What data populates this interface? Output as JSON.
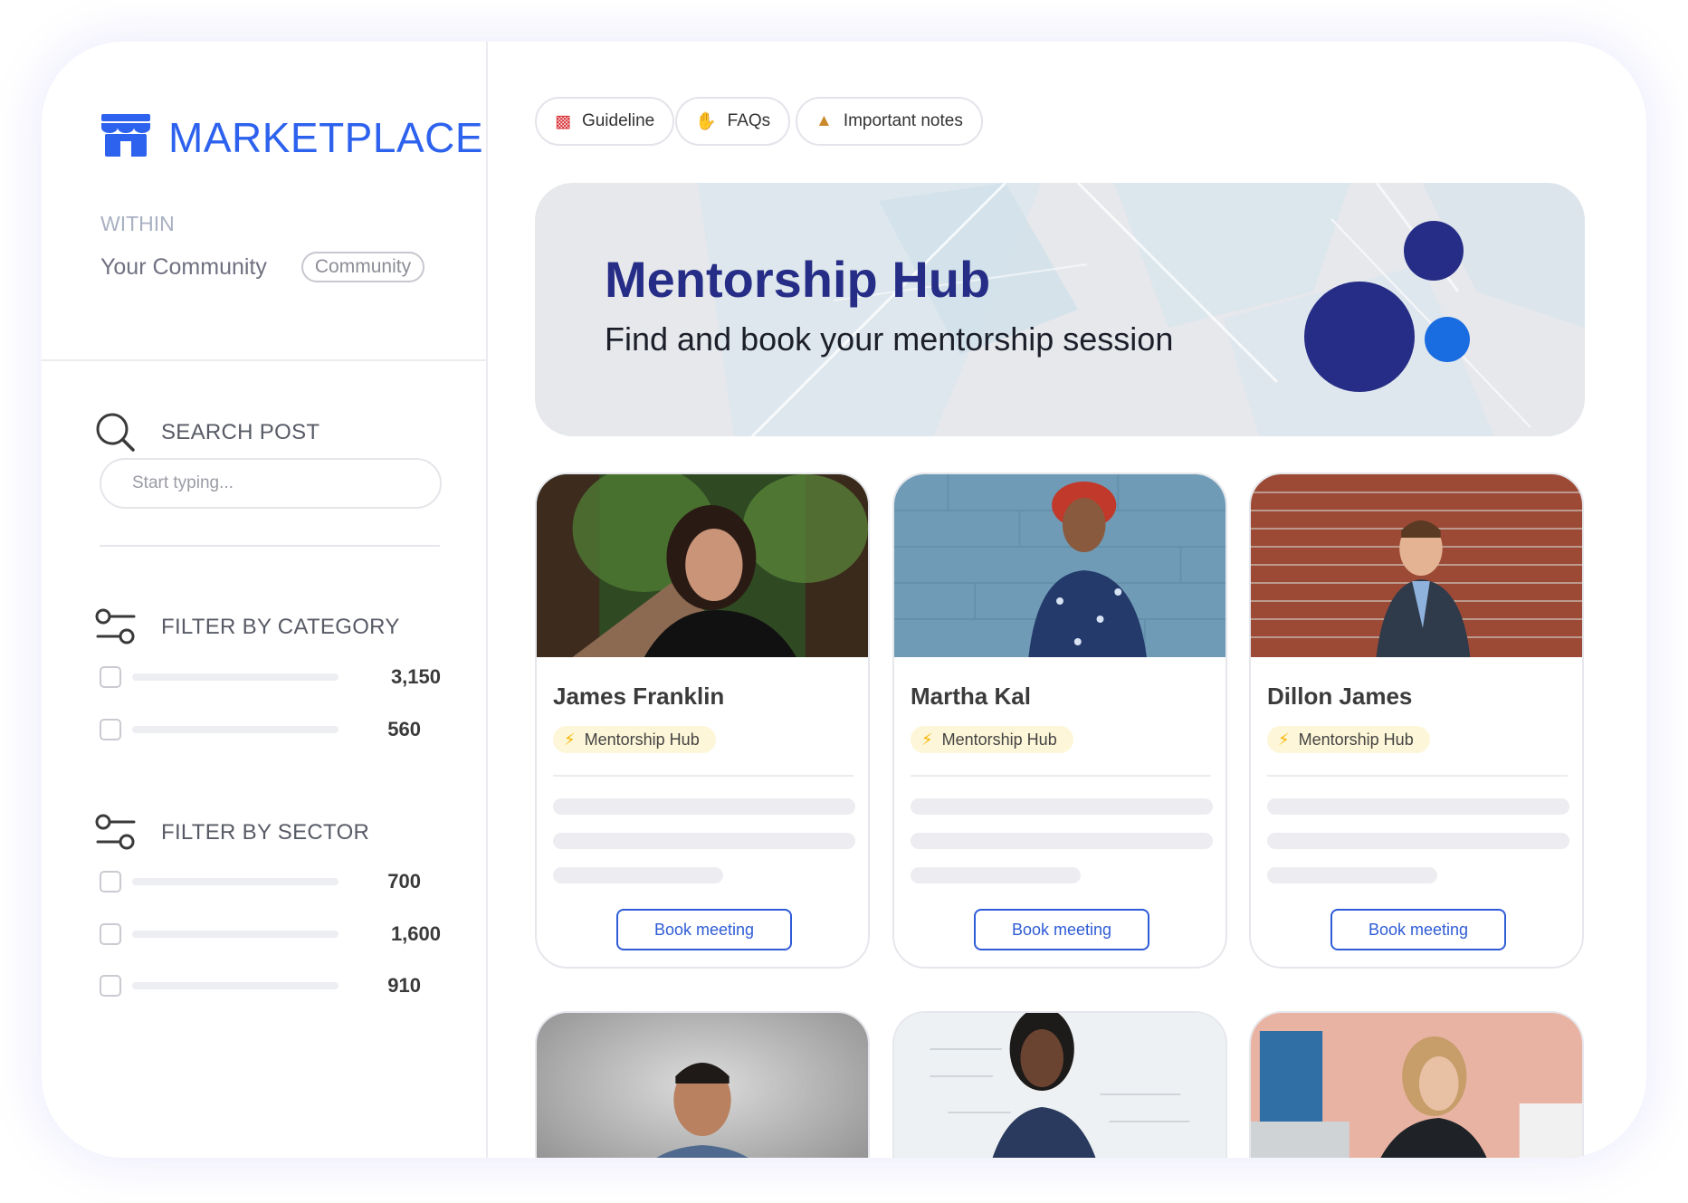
{
  "sidebar": {
    "brand": {
      "title": "MARKETPLACE",
      "icon": "store-icon",
      "color": "#2d62ee"
    },
    "within_label": "WITHIN",
    "community_name": "Your Community",
    "community_tag": "Community",
    "search": {
      "label": "SEARCH POST",
      "icon": "search-icon",
      "placeholder": "Start typing..."
    },
    "filter_category": {
      "label": "FILTER BY CATEGORY",
      "icon": "filter-icon",
      "items": [
        {
          "count": "3,150"
        },
        {
          "count": "560"
        }
      ]
    },
    "filter_sector": {
      "label": "FILTER BY SECTOR",
      "icon": "filter-icon",
      "items": [
        {
          "count": "700"
        },
        {
          "count": "1,600"
        },
        {
          "count": "910"
        }
      ]
    }
  },
  "top_pills": [
    {
      "label": "Guideline",
      "icon": "book-icon"
    },
    {
      "label": "FAQs",
      "icon": "wave-icon"
    },
    {
      "label": "Important notes",
      "icon": "megaphone-icon"
    }
  ],
  "hero": {
    "title": "Mentorship Hub",
    "subtitle": "Find and book your mentorship session",
    "title_color": "#262d86",
    "dot_colors": [
      "#262d86",
      "#1a6de0"
    ]
  },
  "mentors": [
    {
      "name": "James Franklin",
      "badge": "Mentorship Hub",
      "button": "Book meeting"
    },
    {
      "name": "Martha Kal",
      "badge": "Mentorship Hub",
      "button": "Book meeting"
    },
    {
      "name": "Dillon James",
      "badge": "Mentorship Hub",
      "button": "Book meeting"
    }
  ],
  "colors": {
    "accent": "#2e5cd6",
    "badge_bg": "#fdf6d8",
    "bolt": "#f5b400"
  }
}
